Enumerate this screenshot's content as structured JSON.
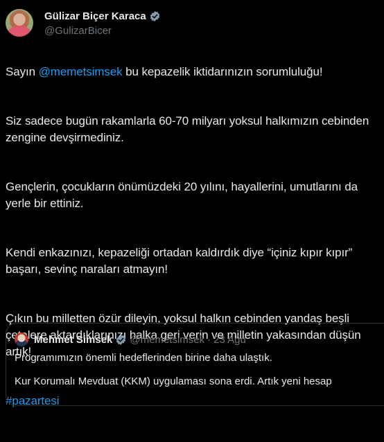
{
  "author": {
    "name": "Gülizar Biçer Karaca",
    "handle": "@GulizarBicer"
  },
  "tweet": {
    "p1_before": "Sayın ",
    "p1_mention": "@memetsimsek",
    "p1_after": " bu kepazelik iktidarınızın sorumluluğu!",
    "p2": "Siz sadece bugün rakamlarla 60-70 milyarı yoksul halkımızın cebinden zengine devşirmediniz.",
    "p3": "Gençlerin, çocukların önümüzdeki 20 yılını, hayallerini, umutlarını da yerle bir ettiniz.",
    "p4": "Kendi enkazınızı, kepazeliği ortadan kaldırdık diye “içiniz kıpır kıpır” başarı, sevinç naraları atmayın!",
    "p5": "Çıkın bu milletten özür dileyin, yoksul halkın cebinden yandaş beşli çetelere aktardıklarınızı halka geri verin ve milletin yakasından düşün artık!",
    "hashtag": "#pazartesi"
  },
  "quote": {
    "name": "Mehmet Simsek",
    "handle": "@memetsimsek",
    "separator": "·",
    "date": "23 Ağu",
    "line1": "Programımızın önemli hedeflerinden birine daha ulaştık.",
    "line2": "Kur Korumalı Mevduat (KKM) uygulaması sona erdi. Artık yeni hesap"
  },
  "colors": {
    "background": "#000000",
    "text": "#e7e9ea",
    "muted": "#71767b",
    "link": "#1d9bf0",
    "verified": "#829aab"
  }
}
